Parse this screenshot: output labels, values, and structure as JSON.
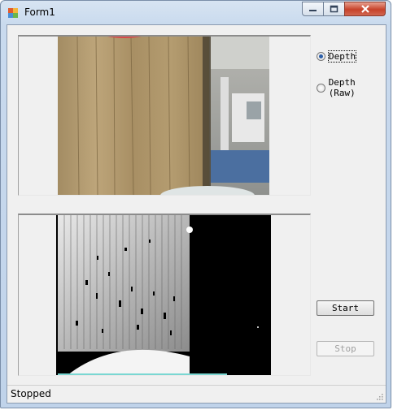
{
  "window": {
    "title": "Form1",
    "title_icon": "windows-forms-app-icon"
  },
  "controls": {
    "minimize_icon": "minimize-icon",
    "maximize_icon": "maximize-icon",
    "close_icon": "close-icon"
  },
  "options": [
    {
      "label": "Depth",
      "selected": true
    },
    {
      "label": "Depth (Raw)",
      "selected": false
    }
  ],
  "buttons": {
    "start_label": "Start",
    "stop_label": "Stop",
    "stop_enabled": false
  },
  "status": {
    "text": "Stopped"
  },
  "colors": {
    "accent": "#2c5ea8",
    "close": "#c7422a"
  }
}
